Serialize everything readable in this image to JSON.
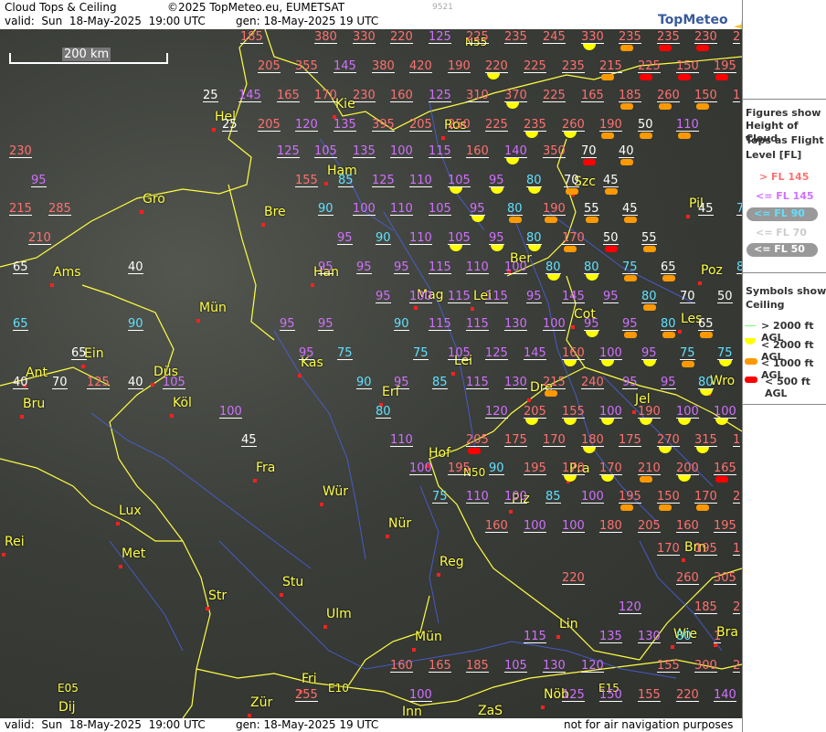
{
  "header": {
    "title": "Cloud Tops & Ceiling",
    "copyright": "©2025 TopMeteo.eu, EUMETSAT",
    "valid_label": "valid:  Sun  18-May-2025  19:00 UTC",
    "gen_label": "gen: 18-May-2025 19 UTC",
    "id_number": "9521",
    "logo_text": "TopMeteo"
  },
  "scale_bar": "200 km",
  "legend": {
    "tops_title_1": "Figures show",
    "tops_title_2": "Height of Cloud",
    "tops_title_3": "Tops as Flight",
    "tops_title_4": "Level  [FL]",
    "gt145": "> FL 145",
    "le145": "<= FL 145",
    "le90": "<= FL 90",
    "le70": "<= FL 70",
    "le50": "<= FL 50",
    "sym_title_1": "Symbols show",
    "sym_title_2": "Ceiling",
    "s2000p": "> 2000 ft AGL",
    "s2000": "< 2000 ft AGL",
    "s1000": "< 1000 ft AGL",
    "s500": "< 500 ft AGL",
    "colors": {
      "gt145": "#ff7070",
      "le145": "#d070ff",
      "le90": "#60e0ff",
      "le70": "#ffffff",
      "le50": "#ffffff"
    }
  },
  "footer": {
    "valid": "valid:  Sun  18-May-2025  19:00 UTC",
    "gen": "gen: 18-May-2025 19 UTC",
    "note": "not for air navigation purposes"
  },
  "cities": [
    [
      "Hel",
      235,
      122
    ],
    [
      "Kie",
      367,
      108
    ],
    [
      "Ros",
      486,
      131
    ],
    [
      "Ham",
      358,
      181
    ],
    [
      "Gro",
      156,
      212
    ],
    [
      "Bre",
      289,
      226
    ],
    [
      "Szc",
      628,
      193
    ],
    [
      "Pil",
      754,
      217
    ],
    [
      "Ber",
      558,
      277
    ],
    [
      "Han",
      343,
      292
    ],
    [
      "Ams",
      58,
      292
    ],
    [
      "Poz",
      767,
      290
    ],
    [
      "Mag",
      456,
      317
    ],
    [
      "Lei",
      518,
      318
    ],
    [
      "Mün",
      218,
      331
    ],
    [
      "Cot",
      628,
      338
    ],
    [
      "Les",
      745,
      343
    ],
    [
      "Ein",
      92,
      381
    ],
    [
      "Kas",
      329,
      391
    ],
    [
      "Lei",
      497,
      389
    ],
    [
      "Ant",
      28,
      402
    ],
    [
      "Düs",
      168,
      401
    ],
    [
      "Wro",
      777,
      411
    ],
    [
      "Erf",
      418,
      423
    ],
    [
      "Dre",
      580,
      418
    ],
    [
      "Bru",
      25,
      436
    ],
    [
      "Köl",
      189,
      435
    ],
    [
      "Jel",
      695,
      431
    ],
    [
      "Hof",
      469,
      490
    ],
    [
      "Fra",
      280,
      506
    ],
    [
      "Pra",
      623,
      507
    ],
    [
      "Wür",
      353,
      532
    ],
    [
      "Plz",
      560,
      540
    ],
    [
      "Lux",
      130,
      553
    ],
    [
      "Nür",
      425,
      567
    ],
    [
      "Rei",
      5,
      587
    ],
    [
      "Brn",
      749,
      593
    ],
    [
      "Met",
      133,
      600
    ],
    [
      "Reg",
      481,
      609
    ],
    [
      "Stu",
      309,
      631
    ],
    [
      "Str",
      228,
      646
    ],
    [
      "Ulm",
      357,
      666
    ],
    [
      "Lin",
      612,
      677
    ],
    [
      "Wie",
      737,
      688
    ],
    [
      "Bra",
      784,
      686
    ],
    [
      "Mün",
      454,
      691
    ],
    [
      "Fri",
      330,
      737
    ],
    [
      "Dij",
      64,
      768
    ],
    [
      "Zür",
      274,
      763
    ],
    [
      "Inn",
      440,
      773
    ],
    [
      "ZaS",
      523,
      772
    ],
    [
      "Nöb",
      595,
      754
    ]
  ],
  "grid_labels": [
    [
      "N55",
      509,
      45
    ],
    [
      "N50",
      507,
      516
    ],
    [
      "E05",
      63,
      752
    ],
    [
      "E10",
      359,
      752
    ],
    [
      "E15",
      655,
      752
    ]
  ],
  "clouds": [
    [
      263,
      40,
      "185",
      "gt"
    ],
    [
      344,
      40,
      "380",
      "gt"
    ],
    [
      386,
      40,
      "330",
      "gt"
    ],
    [
      427,
      40,
      "220",
      "gt"
    ],
    [
      469,
      40,
      "125",
      "le"
    ],
    [
      510,
      40,
      "225",
      "gt"
    ],
    [
      552,
      40,
      "235",
      "gt"
    ],
    [
      594,
      40,
      "245",
      "gt"
    ],
    [
      636,
      40,
      "330",
      "gt",
      "y"
    ],
    [
      677,
      40,
      "235",
      "gt",
      "o"
    ],
    [
      719,
      40,
      "235",
      "gt",
      "r"
    ],
    [
      760,
      40,
      "230",
      "gt",
      "r"
    ],
    [
      802,
      40,
      "2",
      "gt"
    ],
    [
      282,
      72,
      "205",
      "gt"
    ],
    [
      323,
      72,
      "355",
      "gt"
    ],
    [
      365,
      72,
      "145",
      "le"
    ],
    [
      407,
      72,
      "380",
      "gt"
    ],
    [
      448,
      72,
      "420",
      "gt"
    ],
    [
      490,
      72,
      "190",
      "gt"
    ],
    [
      531,
      72,
      "220",
      "gt",
      "y"
    ],
    [
      573,
      72,
      "225",
      "gt"
    ],
    [
      615,
      72,
      "235",
      "gt"
    ],
    [
      656,
      72,
      "215",
      "gt",
      "o"
    ],
    [
      698,
      72,
      "225",
      "gt",
      "r"
    ],
    [
      740,
      72,
      "150",
      "gt",
      "r"
    ],
    [
      781,
      72,
      "195",
      "gt",
      "r"
    ],
    [
      222,
      104,
      "25",
      "w"
    ],
    [
      261,
      104,
      "145",
      "le"
    ],
    [
      303,
      104,
      "165",
      "gt"
    ],
    [
      344,
      104,
      "170",
      "gt"
    ],
    [
      386,
      104,
      "230",
      "gt"
    ],
    [
      427,
      104,
      "160",
      "gt"
    ],
    [
      469,
      104,
      "125",
      "le"
    ],
    [
      510,
      104,
      "310",
      "gt"
    ],
    [
      552,
      104,
      "370",
      "gt",
      "y"
    ],
    [
      594,
      104,
      "225",
      "gt"
    ],
    [
      636,
      104,
      "165",
      "gt"
    ],
    [
      677,
      104,
      "185",
      "gt",
      "o"
    ],
    [
      719,
      104,
      "260",
      "gt",
      "o"
    ],
    [
      760,
      104,
      "150",
      "gt",
      "o"
    ],
    [
      802,
      104,
      "1",
      "gt"
    ],
    [
      243,
      136,
      "25",
      "w"
    ],
    [
      282,
      136,
      "205",
      "gt"
    ],
    [
      323,
      136,
      "120",
      "le"
    ],
    [
      365,
      136,
      "135",
      "le"
    ],
    [
      407,
      136,
      "395",
      "gt"
    ],
    [
      448,
      136,
      "205",
      "gt"
    ],
    [
      490,
      136,
      "250",
      "gt"
    ],
    [
      531,
      136,
      "225",
      "gt"
    ],
    [
      573,
      136,
      "235",
      "gt",
      "y"
    ],
    [
      615,
      136,
      "260",
      "gt",
      "y"
    ],
    [
      656,
      136,
      "190",
      "gt",
      "o"
    ],
    [
      698,
      136,
      "50",
      "w",
      "o"
    ],
    [
      740,
      136,
      "110",
      "le",
      "o"
    ],
    [
      10,
      165,
      "230",
      "gt"
    ],
    [
      303,
      165,
      "125",
      "le"
    ],
    [
      344,
      165,
      "105",
      "le"
    ],
    [
      386,
      165,
      "135",
      "le"
    ],
    [
      427,
      165,
      "100",
      "le"
    ],
    [
      469,
      165,
      "115",
      "le"
    ],
    [
      510,
      165,
      "160",
      "gt"
    ],
    [
      552,
      165,
      "140",
      "le",
      "y"
    ],
    [
      594,
      165,
      "350",
      "gt"
    ],
    [
      636,
      165,
      "70",
      "w",
      "r"
    ],
    [
      677,
      165,
      "40",
      "w",
      "o"
    ],
    [
      34,
      197,
      "95",
      "le"
    ],
    [
      323,
      197,
      "155",
      "gt"
    ],
    [
      370,
      197,
      "85",
      "cy"
    ],
    [
      407,
      197,
      "125",
      "le"
    ],
    [
      448,
      197,
      "110",
      "le"
    ],
    [
      490,
      197,
      "105",
      "le",
      "y"
    ],
    [
      535,
      197,
      "95",
      "le",
      "y"
    ],
    [
      576,
      197,
      "80",
      "cy",
      "y"
    ],
    [
      617,
      197,
      "70",
      "w",
      "o"
    ],
    [
      660,
      197,
      "45",
      "w",
      "o"
    ],
    [
      10,
      228,
      "215",
      "gt"
    ],
    [
      53,
      228,
      "285",
      "gt"
    ],
    [
      348,
      228,
      "90",
      "cy"
    ],
    [
      386,
      228,
      "100",
      "le"
    ],
    [
      427,
      228,
      "110",
      "le"
    ],
    [
      469,
      228,
      "105",
      "le"
    ],
    [
      514,
      228,
      "95",
      "le",
      "y"
    ],
    [
      555,
      228,
      "80",
      "cy",
      "o"
    ],
    [
      594,
      228,
      "190",
      "gt",
      "o"
    ],
    [
      639,
      228,
      "55",
      "w",
      "o"
    ],
    [
      681,
      228,
      "45",
      "w",
      "o"
    ],
    [
      764,
      228,
      "45",
      "w"
    ],
    [
      806,
      228,
      "7",
      "cy"
    ],
    [
      31,
      260,
      "210",
      "gt"
    ],
    [
      369,
      260,
      "95",
      "le"
    ],
    [
      411,
      260,
      "90",
      "cy"
    ],
    [
      448,
      260,
      "110",
      "le"
    ],
    [
      490,
      260,
      "105",
      "le",
      "y"
    ],
    [
      535,
      260,
      "95",
      "le",
      "y"
    ],
    [
      576,
      260,
      "80",
      "cy",
      "y"
    ],
    [
      615,
      260,
      "170",
      "gt",
      "o"
    ],
    [
      660,
      260,
      "50",
      "w",
      "r"
    ],
    [
      702,
      260,
      "55",
      "w",
      "o"
    ],
    [
      14,
      292,
      "65",
      "w"
    ],
    [
      140,
      292,
      "40",
      "w"
    ],
    [
      348,
      292,
      "95",
      "le"
    ],
    [
      390,
      292,
      "95",
      "le"
    ],
    [
      431,
      292,
      "95",
      "le"
    ],
    [
      469,
      292,
      "115",
      "le"
    ],
    [
      510,
      292,
      "110",
      "le"
    ],
    [
      552,
      292,
      "100",
      "le"
    ],
    [
      597,
      292,
      "80",
      "cy",
      "y"
    ],
    [
      639,
      292,
      "80",
      "cy",
      "y"
    ],
    [
      681,
      292,
      "75",
      "cy",
      "o"
    ],
    [
      723,
      292,
      "65",
      "w",
      "o"
    ],
    [
      806,
      292,
      "8",
      "cy"
    ],
    [
      411,
      324,
      "95",
      "le"
    ],
    [
      448,
      324,
      "100",
      "le"
    ],
    [
      490,
      324,
      "115",
      "le"
    ],
    [
      531,
      324,
      "115",
      "le"
    ],
    [
      576,
      324,
      "95",
      "le"
    ],
    [
      615,
      324,
      "145",
      "le"
    ],
    [
      660,
      324,
      "95",
      "le"
    ],
    [
      702,
      324,
      "80",
      "cy",
      "o"
    ],
    [
      744,
      324,
      "70",
      "w"
    ],
    [
      785,
      324,
      "50",
      "w"
    ],
    [
      14,
      354,
      "65",
      "cy"
    ],
    [
      140,
      354,
      "90",
      "cy"
    ],
    [
      306,
      354,
      "95",
      "le"
    ],
    [
      348,
      354,
      "95",
      "le"
    ],
    [
      431,
      354,
      "90",
      "cy"
    ],
    [
      469,
      354,
      "115",
      "le"
    ],
    [
      510,
      354,
      "115",
      "le"
    ],
    [
      552,
      354,
      "130",
      "le"
    ],
    [
      594,
      354,
      "100",
      "le"
    ],
    [
      639,
      354,
      "95",
      "le",
      "y"
    ],
    [
      681,
      354,
      "95",
      "le",
      "o"
    ],
    [
      723,
      354,
      "80",
      "cy",
      "o"
    ],
    [
      764,
      354,
      "65",
      "w",
      "o"
    ],
    [
      78,
      386,
      "65",
      "w"
    ],
    [
      327,
      386,
      "95",
      "le"
    ],
    [
      369,
      386,
      "75",
      "cy"
    ],
    [
      452,
      386,
      "75",
      "cy"
    ],
    [
      490,
      386,
      "105",
      "le"
    ],
    [
      531,
      386,
      "125",
      "le"
    ],
    [
      573,
      386,
      "145",
      "le"
    ],
    [
      615,
      386,
      "160",
      "gt",
      "y"
    ],
    [
      656,
      386,
      "100",
      "le",
      "y"
    ],
    [
      702,
      386,
      "95",
      "le",
      "y"
    ],
    [
      744,
      386,
      "75",
      "cy",
      "o"
    ],
    [
      785,
      386,
      "75",
      "cy",
      "y"
    ],
    [
      14,
      418,
      "40",
      "w"
    ],
    [
      57,
      418,
      "70",
      "w"
    ],
    [
      95,
      418,
      "125",
      "gt"
    ],
    [
      140,
      418,
      "40",
      "w"
    ],
    [
      178,
      418,
      "105",
      "le"
    ],
    [
      390,
      418,
      "90",
      "cy"
    ],
    [
      431,
      418,
      "95",
      "le"
    ],
    [
      473,
      418,
      "85",
      "cy"
    ],
    [
      510,
      418,
      "115",
      "le"
    ],
    [
      552,
      418,
      "130",
      "le"
    ],
    [
      594,
      418,
      "215",
      "gt",
      "o"
    ],
    [
      636,
      418,
      "240",
      "gt"
    ],
    [
      681,
      418,
      "95",
      "le"
    ],
    [
      723,
      418,
      "95",
      "le"
    ],
    [
      764,
      418,
      "80",
      "cy",
      "y"
    ],
    [
      240,
      450,
      "100",
      "le"
    ],
    [
      411,
      450,
      "80",
      "cy"
    ],
    [
      531,
      450,
      "120",
      "le"
    ],
    [
      573,
      450,
      "205",
      "gt",
      "y"
    ],
    [
      615,
      450,
      "155",
      "gt",
      "y"
    ],
    [
      656,
      450,
      "100",
      "le",
      "y"
    ],
    [
      698,
      450,
      "190",
      "gt",
      "y"
    ],
    [
      740,
      450,
      "100",
      "le",
      "y"
    ],
    [
      781,
      450,
      "100",
      "le",
      "y"
    ],
    [
      264,
      481,
      "45",
      "w"
    ],
    [
      427,
      481,
      "110",
      "le"
    ],
    [
      510,
      481,
      "205",
      "gt",
      "r"
    ],
    [
      552,
      481,
      "175",
      "gt"
    ],
    [
      594,
      481,
      "170",
      "gt"
    ],
    [
      636,
      481,
      "180",
      "gt",
      "y"
    ],
    [
      677,
      481,
      "175",
      "gt"
    ],
    [
      719,
      481,
      "270",
      "gt",
      "y"
    ],
    [
      760,
      481,
      "315",
      "gt",
      "y"
    ],
    [
      802,
      481,
      "1",
      "gt"
    ],
    [
      448,
      512,
      "100",
      "le"
    ],
    [
      490,
      512,
      "195",
      "gt"
    ],
    [
      535,
      512,
      "90",
      "cy"
    ],
    [
      573,
      512,
      "195",
      "gt"
    ],
    [
      615,
      512,
      "170",
      "gt",
      "y"
    ],
    [
      656,
      512,
      "170",
      "gt",
      "y"
    ],
    [
      698,
      512,
      "210",
      "gt",
      "o"
    ],
    [
      740,
      512,
      "200",
      "gt",
      "y"
    ],
    [
      781,
      512,
      "165",
      "gt",
      "r"
    ],
    [
      473,
      543,
      "75",
      "cy"
    ],
    [
      510,
      543,
      "110",
      "le"
    ],
    [
      552,
      543,
      "100",
      "le"
    ],
    [
      597,
      543,
      "85",
      "cy"
    ],
    [
      636,
      543,
      "100",
      "le"
    ],
    [
      677,
      543,
      "195",
      "gt",
      "o"
    ],
    [
      719,
      543,
      "150",
      "gt",
      "o"
    ],
    [
      760,
      543,
      "170",
      "gt",
      "o"
    ],
    [
      802,
      543,
      "2",
      "gt"
    ],
    [
      531,
      575,
      "160",
      "gt"
    ],
    [
      573,
      575,
      "100",
      "le"
    ],
    [
      615,
      575,
      "100",
      "le"
    ],
    [
      656,
      575,
      "180",
      "gt"
    ],
    [
      698,
      575,
      "205",
      "gt"
    ],
    [
      740,
      575,
      "160",
      "gt"
    ],
    [
      781,
      575,
      "195",
      "gt"
    ],
    [
      719,
      600,
      "170",
      "gt"
    ],
    [
      760,
      600,
      "195",
      "gt"
    ],
    [
      802,
      600,
      "1",
      "gt"
    ],
    [
      615,
      632,
      "220",
      "gt"
    ],
    [
      740,
      632,
      "260",
      "gt"
    ],
    [
      781,
      632,
      "305",
      "gt"
    ],
    [
      677,
      664,
      "120",
      "le"
    ],
    [
      760,
      664,
      "185",
      "gt"
    ],
    [
      802,
      664,
      "2",
      "gt"
    ],
    [
      573,
      696,
      "115",
      "le"
    ],
    [
      656,
      696,
      "135",
      "le"
    ],
    [
      698,
      696,
      "130",
      "le"
    ],
    [
      740,
      696,
      "80",
      "cy"
    ],
    [
      781,
      696,
      "1",
      "gt"
    ],
    [
      427,
      728,
      "160",
      "gt"
    ],
    [
      469,
      728,
      "165",
      "gt"
    ],
    [
      510,
      728,
      "185",
      "gt"
    ],
    [
      552,
      728,
      "105",
      "le"
    ],
    [
      594,
      728,
      "130",
      "le"
    ],
    [
      636,
      728,
      "120",
      "le"
    ],
    [
      719,
      728,
      "155",
      "gt"
    ],
    [
      760,
      728,
      "300",
      "gt"
    ],
    [
      802,
      728,
      "2",
      "gt"
    ],
    [
      323,
      760,
      "255",
      "gt"
    ],
    [
      448,
      760,
      "100",
      "le"
    ],
    [
      615,
      760,
      "125",
      "le"
    ],
    [
      656,
      760,
      "150",
      "le"
    ],
    [
      698,
      760,
      "155",
      "gt"
    ],
    [
      740,
      760,
      "220",
      "gt"
    ],
    [
      781,
      760,
      "140",
      "le"
    ]
  ]
}
